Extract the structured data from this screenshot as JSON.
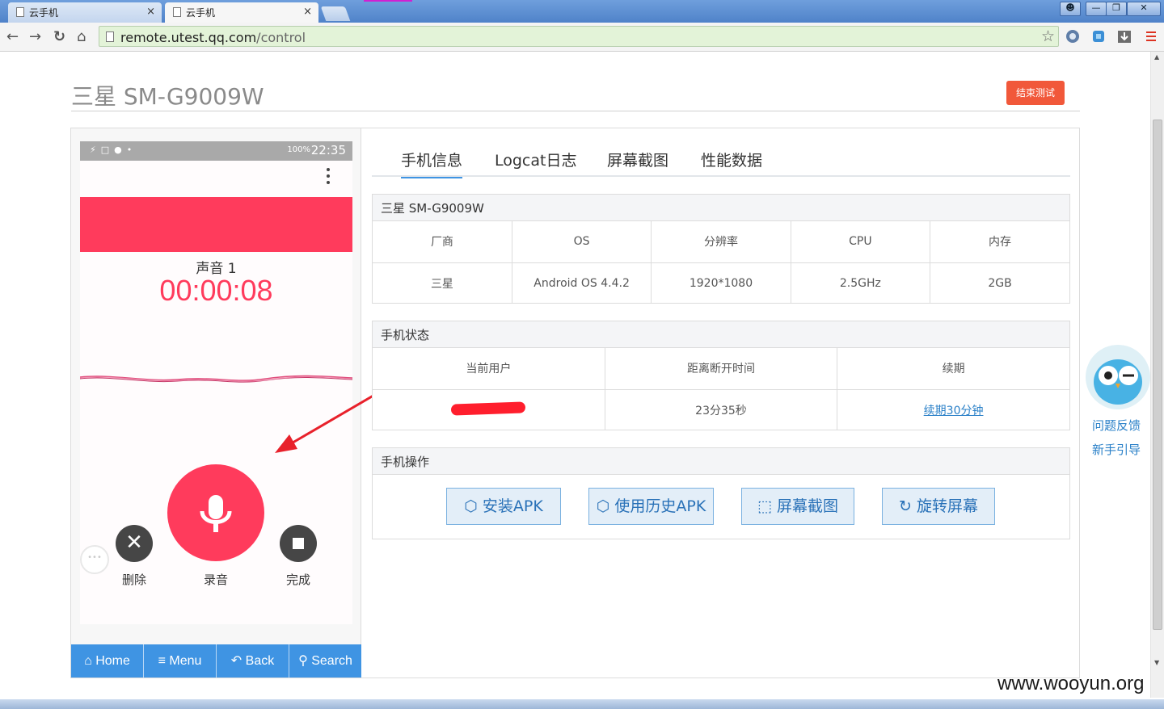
{
  "browser": {
    "tabs": [
      {
        "label": "云手机",
        "active": false
      },
      {
        "label": "云手机",
        "active": true
      }
    ],
    "url_host": "remote.utest.qq.com",
    "url_path": "/control"
  },
  "page": {
    "title": "三星 SM-G9009W",
    "end_test_label": "结束测试"
  },
  "phone": {
    "status_time": "22:35",
    "battery_pct": "100%",
    "recording_name": "声音 1",
    "recording_time": "00:00:08",
    "delete_label": "删除",
    "record_label": "录音",
    "done_label": "完成",
    "bubble_text": "•••"
  },
  "phone_nav": {
    "home": "Home",
    "menu": "Menu",
    "back": "Back",
    "search": "Search"
  },
  "tabs": [
    "手机信息",
    "Logcat日志",
    "屏幕截图",
    "性能数据"
  ],
  "device_info": {
    "header": "三星 SM-G9009W",
    "columns": [
      "厂商",
      "OS",
      "分辨率",
      "CPU",
      "内存"
    ],
    "values": [
      "三星",
      "Android OS 4.4.2",
      "1920*1080",
      "2.5GHz",
      "2GB"
    ]
  },
  "phone_status": {
    "header": "手机状态",
    "columns": [
      "当前用户",
      "距离断开时间",
      "续期"
    ],
    "disconnect_time": "23分35秒",
    "renew_link": "续期30分钟"
  },
  "phone_ops": {
    "header": "手机操作",
    "buttons": [
      "安装APK",
      "使用历史APK",
      "屏幕截图",
      "旋转屏幕"
    ]
  },
  "side": {
    "feedback": "问题反馈",
    "guide": "新手引导"
  },
  "watermark": "www.wooyun.org",
  "colors": {
    "accent": "#3f94e3",
    "recorder_red": "#ff3b5c",
    "end_button": "#f1583a"
  }
}
